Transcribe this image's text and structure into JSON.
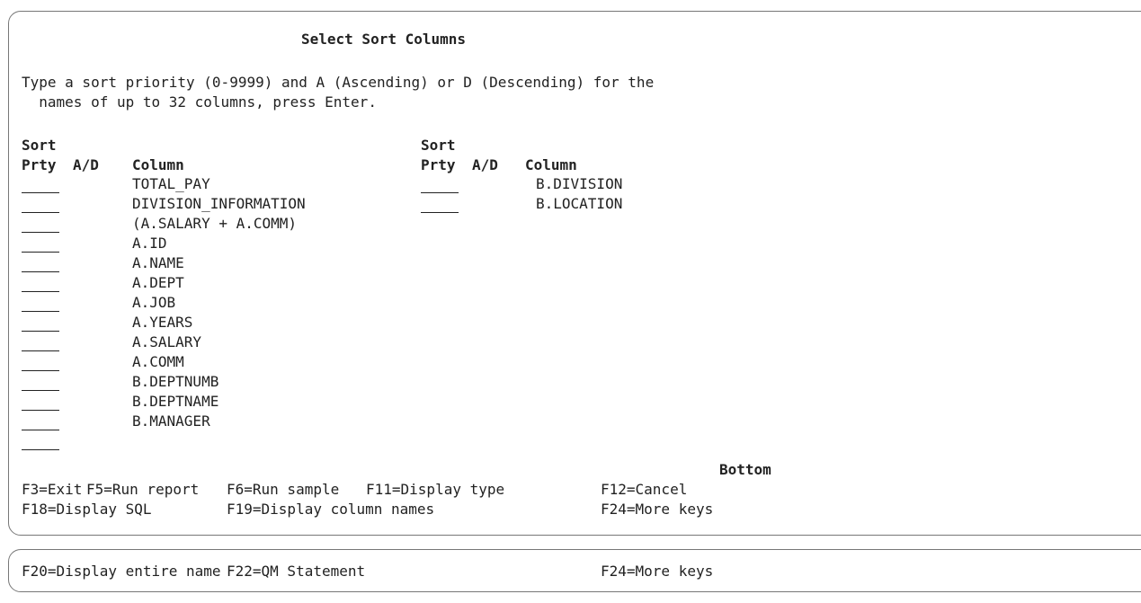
{
  "screen": {
    "title": "Select Sort Columns",
    "instructions": [
      "Type a sort priority (0-9999) and A (Ascending) or D (Descending) for the",
      "  names of up to 32 columns, press Enter."
    ],
    "headers": {
      "sort": "Sort",
      "prty": "Prty",
      "ad": "A/D",
      "column": "Column"
    },
    "left_columns": [
      {
        "prty": "",
        "name": "TOTAL_PAY"
      },
      {
        "prty": "",
        "name": "DIVISION_INFORMATION"
      },
      {
        "prty": "",
        "name": "(A.SALARY + A.COMM)"
      },
      {
        "prty": "",
        "name": "A.ID"
      },
      {
        "prty": "",
        "name": "A.NAME"
      },
      {
        "prty": "",
        "name": "A.DEPT"
      },
      {
        "prty": "",
        "name": "A.JOB"
      },
      {
        "prty": "",
        "name": "A.YEARS"
      },
      {
        "prty": "",
        "name": "A.SALARY"
      },
      {
        "prty": "",
        "name": "A.COMM"
      },
      {
        "prty": "",
        "name": "B.DEPTNUMB"
      },
      {
        "prty": "",
        "name": "B.DEPTNAME"
      },
      {
        "prty": "",
        "name": "B.MANAGER"
      },
      {
        "prty": "",
        "name": ""
      }
    ],
    "right_columns": [
      {
        "prty": "",
        "name": "B.DIVISION"
      },
      {
        "prty": "",
        "name": "B.LOCATION"
      }
    ],
    "scroll_indicator": "Bottom",
    "fkeys_line1": [
      "F3=Exit",
      "F5=Run report",
      "F6=Run sample",
      "F11=Display type",
      "F12=Cancel"
    ],
    "fkeys_line2": [
      "F18=Display SQL",
      "F19=Display column names",
      "F24=More keys"
    ]
  },
  "more_keys": [
    "F20=Display entire name",
    "F22=QM Statement",
    "F24=More keys"
  ]
}
